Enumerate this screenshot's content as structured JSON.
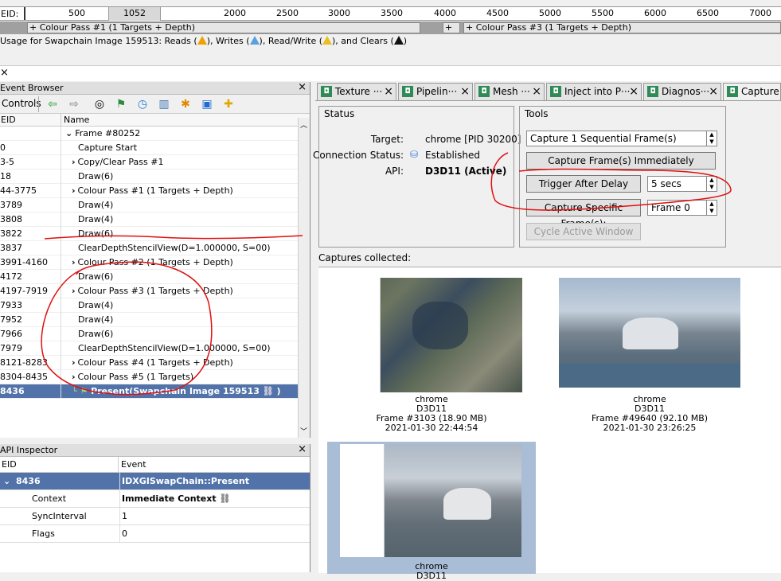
{
  "timeline": {
    "eid_label": "EID:",
    "ticks": [
      "500",
      "1052",
      "2000",
      "2500",
      "3000",
      "3500",
      "4000",
      "4500",
      "5000",
      "5500",
      "6000",
      "6500",
      "7000"
    ],
    "passes": [
      "+ Colour Pass #1 (1 Targets + Depth)",
      "+",
      "+ Colour Pass #3 (1 Targets + Depth)"
    ],
    "usage_prefix": "Usage for Swapchain Image 159513: Reads (",
    "usage_writes": "), Writes (",
    "usage_rw": "), Read/Write (",
    "usage_clears": "), and Clears (",
    "usage_suffix": ")"
  },
  "top_close": "×",
  "event_browser": {
    "title": "Event Browser",
    "close": "×",
    "controls_label": "Controls",
    "col_eid": "EID",
    "col_name": "Name",
    "rows": [
      {
        "eid": "",
        "name": "Frame #80252",
        "arrow": "⌄"
      },
      {
        "eid": "0",
        "name": "Capture Start",
        "arrow": ""
      },
      {
        "eid": "3-5",
        "name": "Copy/Clear Pass #1",
        "arrow": "›"
      },
      {
        "eid": "18",
        "name": "Draw(6)",
        "arrow": ""
      },
      {
        "eid": "44-3775",
        "name": "Colour Pass #1 (1 Targets + Depth)",
        "arrow": "›"
      },
      {
        "eid": "3789",
        "name": "Draw(4)",
        "arrow": ""
      },
      {
        "eid": "3808",
        "name": "Draw(4)",
        "arrow": ""
      },
      {
        "eid": "3822",
        "name": "Draw(6)",
        "arrow": ""
      },
      {
        "eid": "3837",
        "name": "ClearDepthStencilView(D=1.000000, S=00)",
        "arrow": ""
      },
      {
        "eid": "3991-4160",
        "name": "Colour Pass #2 (1 Targets + Depth)",
        "arrow": "›"
      },
      {
        "eid": "4172",
        "name": "Draw(6)",
        "arrow": ""
      },
      {
        "eid": "4197-7919",
        "name": "Colour Pass #3 (1 Targets + Depth)",
        "arrow": "›"
      },
      {
        "eid": "7933",
        "name": "Draw(4)",
        "arrow": ""
      },
      {
        "eid": "7952",
        "name": "Draw(4)",
        "arrow": ""
      },
      {
        "eid": "7966",
        "name": "Draw(6)",
        "arrow": ""
      },
      {
        "eid": "7979",
        "name": "ClearDepthStencilView(D=1.000000, S=00)",
        "arrow": ""
      },
      {
        "eid": "8121-8283",
        "name": "Colour Pass #4 (1 Targets + Depth)",
        "arrow": "›"
      },
      {
        "eid": "8304-8435",
        "name": "Colour Pass #5 (1 Targets)",
        "arrow": "›"
      },
      {
        "eid": "8436",
        "name": "Present(Swapchain Image 159513",
        "arrow": "",
        "suffix": ")"
      }
    ]
  },
  "api_inspector": {
    "title": "API Inspector",
    "close": "×",
    "col_eid": "EID",
    "col_event": "Event",
    "rows": [
      {
        "c1": "8436",
        "c2": "IDXGISwapChain::Present"
      },
      {
        "c1": "Context",
        "c2": "Immediate Context"
      },
      {
        "c1": "SyncInterval",
        "c2": "1"
      },
      {
        "c1": "Flags",
        "c2": "0"
      }
    ]
  },
  "tabs": [
    {
      "label": "Texture ···",
      "close": "×"
    },
    {
      "label": "Pipelin···",
      "close": "×"
    },
    {
      "label": "Mesh ···",
      "close": "×"
    },
    {
      "label": "Inject into P···",
      "close": "×"
    },
    {
      "label": "Diagnos···",
      "close": "×"
    },
    {
      "label": "Capture C",
      "close": ""
    }
  ],
  "status": {
    "title": "Status",
    "target_label": "Target:",
    "target_value": "chrome [PID 30200]",
    "conn_label": "Connection Status:",
    "conn_value": "Established",
    "api_label": "API:",
    "api_value": "D3D11 (Active)"
  },
  "tools": {
    "title": "Tools",
    "frames_select": "Capture 1 Sequential Frame(s)",
    "capture_now": "Capture Frame(s) Immediately",
    "trigger_delay": "Trigger After Delay",
    "delay_value": "5 secs",
    "capture_specific": "Capture Specific Frame(s):",
    "frame_value": "Frame 0",
    "cycle_window": "Cycle Active Window"
  },
  "captures": {
    "label": "Captures collected:",
    "items": [
      {
        "app": "chrome",
        "api": "D3D11",
        "frame": "Frame #3103 (18.90 MB)",
        "time": "2021-01-30 22:44:54"
      },
      {
        "app": "chrome",
        "api": "D3D11",
        "frame": "Frame #49640 (92.10 MB)",
        "time": "2021-01-30 23:26:25"
      },
      {
        "app": "chrome",
        "api": "D3D11",
        "frame": "",
        "time": ""
      }
    ]
  },
  "colors": {
    "selection": "#5173a9",
    "annotation": "#e01010",
    "tab_icon": "#2e8b57"
  }
}
